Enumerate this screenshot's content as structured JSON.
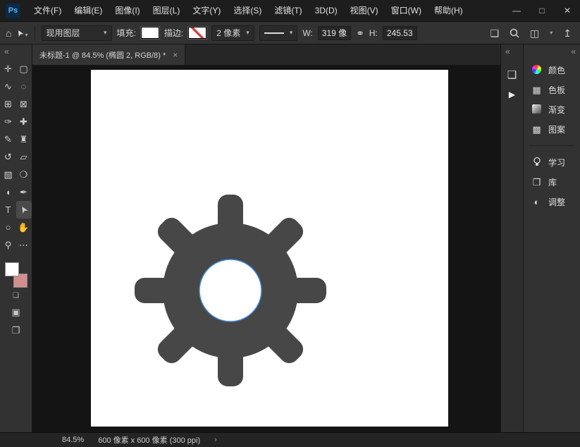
{
  "titlebar": {
    "logo": "Ps",
    "menus": [
      "文件(F)",
      "编辑(E)",
      "图像(I)",
      "图层(L)",
      "文字(Y)",
      "选择(S)",
      "滤镜(T)",
      "3D(D)",
      "视图(V)",
      "窗口(W)",
      "帮助(H)"
    ],
    "window": {
      "minimize": "—",
      "maximize": "□",
      "close": "✕"
    }
  },
  "options_bar": {
    "preset_dropdown": "现用图层",
    "fill_label": "填充:",
    "stroke_label": "描边:",
    "stroke_width_value": "2 像素",
    "w_label": "W:",
    "w_value": "319 像",
    "h_label": "H:",
    "h_value": "245.53"
  },
  "tab": {
    "title": "未标题-1 @ 84.5% (椭圆 2, RGB/8) *",
    "close": "×"
  },
  "toolbar": {
    "tools": [
      {
        "name": "move",
        "glyph": "✛"
      },
      {
        "name": "marquee",
        "glyph": "▢"
      },
      {
        "name": "lasso",
        "glyph": "∿"
      },
      {
        "name": "object-selection",
        "glyph": "◌"
      },
      {
        "name": "crop",
        "glyph": "⊞"
      },
      {
        "name": "frame",
        "glyph": "⊠"
      },
      {
        "name": "eyedropper",
        "glyph": "✑"
      },
      {
        "name": "healing-brush",
        "glyph": "✚"
      },
      {
        "name": "brush",
        "glyph": "✎"
      },
      {
        "name": "clone-stamp",
        "glyph": "♜"
      },
      {
        "name": "history-brush",
        "glyph": "↺"
      },
      {
        "name": "eraser",
        "glyph": "▱"
      },
      {
        "name": "gradient",
        "glyph": "▧"
      },
      {
        "name": "blur",
        "glyph": "❍"
      },
      {
        "name": "dodge",
        "glyph": "◖"
      },
      {
        "name": "pen",
        "glyph": "✒"
      },
      {
        "name": "type",
        "glyph": "T"
      },
      {
        "name": "path-selection",
        "glyph": "➤"
      },
      {
        "name": "ellipse",
        "glyph": "○"
      },
      {
        "name": "hand",
        "glyph": "✋"
      },
      {
        "name": "zoom",
        "glyph": "⚲"
      },
      {
        "name": "more-tools",
        "glyph": "⋯"
      }
    ]
  },
  "right_panel": {
    "items": [
      {
        "label": "颜色"
      },
      {
        "label": "色板"
      },
      {
        "label": "渐变"
      },
      {
        "label": "图案"
      },
      {
        "label": "学习"
      },
      {
        "label": "库"
      },
      {
        "label": "调整"
      }
    ]
  },
  "status_bar": {
    "zoom": "84.5%",
    "doc_info": "600 像素 x 600 像素 (300 ppi)",
    "chevron": "›"
  },
  "icons": {
    "home": "⌂",
    "tool_arrow": "➤",
    "chevron_down": "▾",
    "link": "⚭",
    "stack": "❏",
    "panel": "◫",
    "share": "↥",
    "collapse": "«",
    "play": "▶",
    "strip_panel": "❑",
    "swatches_grid": "▦",
    "pattern": "▩",
    "libraries": "❒",
    "adjustments": "◐",
    "mini_default": "❏",
    "quick_mask": "▣",
    "screen_mode": "❐"
  },
  "colors": {
    "foreground": "#ffffff",
    "background": "#d48e8e",
    "fill_swatch": "#ffffff",
    "gear": "#474747",
    "selection_stroke": "#3d8ae0",
    "canvas": "#ffffff"
  }
}
